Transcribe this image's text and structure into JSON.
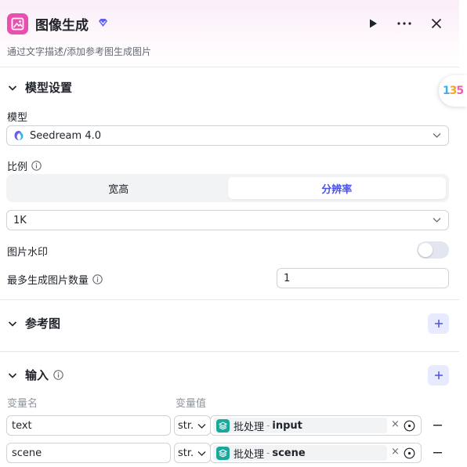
{
  "header": {
    "title": "图像生成",
    "subtitle": "通过文字描述/添加参考图生成图片",
    "icons": [
      "image-icon",
      "diamond-vip-icon",
      "play-icon",
      "more-icon",
      "close-icon"
    ]
  },
  "side_badge": {
    "chars": [
      "1",
      "3",
      "5"
    ]
  },
  "model_settings": {
    "title": "模型设置",
    "model_label": "模型",
    "model_value": "Seedream 4.0",
    "ratio_label": "比例",
    "ratio_tabs": [
      "宽高",
      "分辨率"
    ],
    "active_tab": "分辨率",
    "resolution_value": "1K",
    "watermark_label": "图片水印",
    "watermark_on": false,
    "max_images_label": "最多生成图片数量",
    "max_images_value": "1"
  },
  "reference": {
    "title": "参考图"
  },
  "inputs": {
    "title": "输入",
    "col_name": "变量名",
    "col_value": "变量值",
    "rows": [
      {
        "name": "text",
        "type": "str.",
        "source": "批处理",
        "sep": "-",
        "var": "input"
      },
      {
        "name": "scene",
        "type": "str.",
        "source": "批处理",
        "sep": "-",
        "var": "scene"
      }
    ]
  },
  "colors": {
    "accent": "#4d53e8",
    "brand": "#e94fb0",
    "chip_icon": "#1aa89a"
  }
}
